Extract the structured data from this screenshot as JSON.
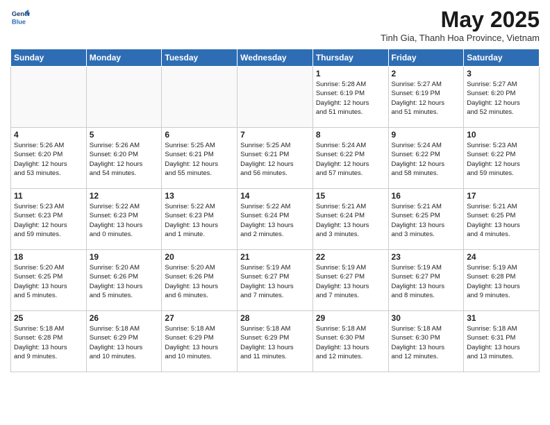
{
  "header": {
    "logo_line1": "General",
    "logo_line2": "Blue",
    "month": "May 2025",
    "location": "Tinh Gia, Thanh Hoa Province, Vietnam"
  },
  "days_of_week": [
    "Sunday",
    "Monday",
    "Tuesday",
    "Wednesday",
    "Thursday",
    "Friday",
    "Saturday"
  ],
  "weeks": [
    [
      {
        "day": "",
        "info": ""
      },
      {
        "day": "",
        "info": ""
      },
      {
        "day": "",
        "info": ""
      },
      {
        "day": "",
        "info": ""
      },
      {
        "day": "1",
        "info": "Sunrise: 5:28 AM\nSunset: 6:19 PM\nDaylight: 12 hours\nand 51 minutes."
      },
      {
        "day": "2",
        "info": "Sunrise: 5:27 AM\nSunset: 6:19 PM\nDaylight: 12 hours\nand 51 minutes."
      },
      {
        "day": "3",
        "info": "Sunrise: 5:27 AM\nSunset: 6:20 PM\nDaylight: 12 hours\nand 52 minutes."
      }
    ],
    [
      {
        "day": "4",
        "info": "Sunrise: 5:26 AM\nSunset: 6:20 PM\nDaylight: 12 hours\nand 53 minutes."
      },
      {
        "day": "5",
        "info": "Sunrise: 5:26 AM\nSunset: 6:20 PM\nDaylight: 12 hours\nand 54 minutes."
      },
      {
        "day": "6",
        "info": "Sunrise: 5:25 AM\nSunset: 6:21 PM\nDaylight: 12 hours\nand 55 minutes."
      },
      {
        "day": "7",
        "info": "Sunrise: 5:25 AM\nSunset: 6:21 PM\nDaylight: 12 hours\nand 56 minutes."
      },
      {
        "day": "8",
        "info": "Sunrise: 5:24 AM\nSunset: 6:22 PM\nDaylight: 12 hours\nand 57 minutes."
      },
      {
        "day": "9",
        "info": "Sunrise: 5:24 AM\nSunset: 6:22 PM\nDaylight: 12 hours\nand 58 minutes."
      },
      {
        "day": "10",
        "info": "Sunrise: 5:23 AM\nSunset: 6:22 PM\nDaylight: 12 hours\nand 59 minutes."
      }
    ],
    [
      {
        "day": "11",
        "info": "Sunrise: 5:23 AM\nSunset: 6:23 PM\nDaylight: 12 hours\nand 59 minutes."
      },
      {
        "day": "12",
        "info": "Sunrise: 5:22 AM\nSunset: 6:23 PM\nDaylight: 13 hours\nand 0 minutes."
      },
      {
        "day": "13",
        "info": "Sunrise: 5:22 AM\nSunset: 6:23 PM\nDaylight: 13 hours\nand 1 minute."
      },
      {
        "day": "14",
        "info": "Sunrise: 5:22 AM\nSunset: 6:24 PM\nDaylight: 13 hours\nand 2 minutes."
      },
      {
        "day": "15",
        "info": "Sunrise: 5:21 AM\nSunset: 6:24 PM\nDaylight: 13 hours\nand 3 minutes."
      },
      {
        "day": "16",
        "info": "Sunrise: 5:21 AM\nSunset: 6:25 PM\nDaylight: 13 hours\nand 3 minutes."
      },
      {
        "day": "17",
        "info": "Sunrise: 5:21 AM\nSunset: 6:25 PM\nDaylight: 13 hours\nand 4 minutes."
      }
    ],
    [
      {
        "day": "18",
        "info": "Sunrise: 5:20 AM\nSunset: 6:25 PM\nDaylight: 13 hours\nand 5 minutes."
      },
      {
        "day": "19",
        "info": "Sunrise: 5:20 AM\nSunset: 6:26 PM\nDaylight: 13 hours\nand 5 minutes."
      },
      {
        "day": "20",
        "info": "Sunrise: 5:20 AM\nSunset: 6:26 PM\nDaylight: 13 hours\nand 6 minutes."
      },
      {
        "day": "21",
        "info": "Sunrise: 5:19 AM\nSunset: 6:27 PM\nDaylight: 13 hours\nand 7 minutes."
      },
      {
        "day": "22",
        "info": "Sunrise: 5:19 AM\nSunset: 6:27 PM\nDaylight: 13 hours\nand 7 minutes."
      },
      {
        "day": "23",
        "info": "Sunrise: 5:19 AM\nSunset: 6:27 PM\nDaylight: 13 hours\nand 8 minutes."
      },
      {
        "day": "24",
        "info": "Sunrise: 5:19 AM\nSunset: 6:28 PM\nDaylight: 13 hours\nand 9 minutes."
      }
    ],
    [
      {
        "day": "25",
        "info": "Sunrise: 5:18 AM\nSunset: 6:28 PM\nDaylight: 13 hours\nand 9 minutes."
      },
      {
        "day": "26",
        "info": "Sunrise: 5:18 AM\nSunset: 6:29 PM\nDaylight: 13 hours\nand 10 minutes."
      },
      {
        "day": "27",
        "info": "Sunrise: 5:18 AM\nSunset: 6:29 PM\nDaylight: 13 hours\nand 10 minutes."
      },
      {
        "day": "28",
        "info": "Sunrise: 5:18 AM\nSunset: 6:29 PM\nDaylight: 13 hours\nand 11 minutes."
      },
      {
        "day": "29",
        "info": "Sunrise: 5:18 AM\nSunset: 6:30 PM\nDaylight: 13 hours\nand 12 minutes."
      },
      {
        "day": "30",
        "info": "Sunrise: 5:18 AM\nSunset: 6:30 PM\nDaylight: 13 hours\nand 12 minutes."
      },
      {
        "day": "31",
        "info": "Sunrise: 5:18 AM\nSunset: 6:31 PM\nDaylight: 13 hours\nand 13 minutes."
      }
    ]
  ]
}
